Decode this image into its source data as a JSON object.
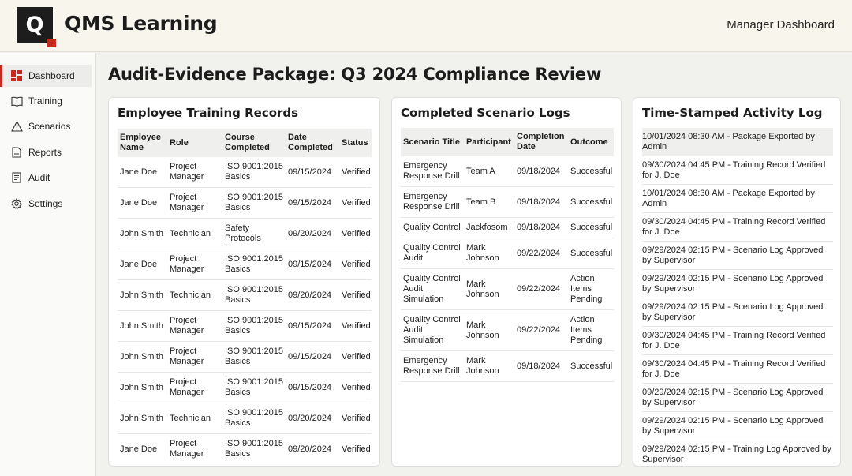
{
  "header": {
    "logo_letter": "Q",
    "app_title": "QMS Learning",
    "right_label": "Manager Dashboard"
  },
  "sidebar": {
    "items": [
      {
        "label": "Dashboard",
        "icon": "dashboard-icon",
        "active": true
      },
      {
        "label": "Training",
        "icon": "book-icon",
        "active": false
      },
      {
        "label": "Scenarios",
        "icon": "warning-icon",
        "active": false
      },
      {
        "label": "Reports",
        "icon": "document-icon",
        "active": false
      },
      {
        "label": "Audit",
        "icon": "clipboard-icon",
        "active": false
      },
      {
        "label": "Settings",
        "icon": "gear-icon",
        "active": false
      }
    ]
  },
  "page_title": "Audit-Evidence Package: Q3 2024 Compliance Review",
  "training": {
    "title": "Employee Training Records",
    "headers": [
      "Employee Name",
      "Role",
      "Course Completed",
      "Date Completed",
      "Status"
    ],
    "rows": [
      [
        "Jane Doe",
        "Project Manager",
        "ISO 9001:2015 Basics",
        "09/15/2024",
        "Verified"
      ],
      [
        "Jane Doe",
        "Project Manager",
        "ISO 9001:2015 Basics",
        "09/15/2024",
        "Verified"
      ],
      [
        "John Smith",
        "Technician",
        "Safety Protocols",
        "09/20/2024",
        "Verified"
      ],
      [
        "Jane Doe",
        "Project Manager",
        "ISO 9001:2015 Basics",
        "09/15/2024",
        "Verified"
      ],
      [
        "John Smith",
        "Technician",
        "ISO 9001:2015 Basics",
        "09/20/2024",
        "Verified"
      ],
      [
        "John Smith",
        "Project Manager",
        "ISO 9001:2015 Basics",
        "09/15/2024",
        "Verified"
      ],
      [
        "John Smith",
        "Project Manager",
        "ISO 9001:2015 Basics",
        "09/15/2024",
        "Verified"
      ],
      [
        "John Smith",
        "Project Manager",
        "ISO 9001:2015 Basics",
        "09/15/2024",
        "Verified"
      ],
      [
        "John Smith",
        "Technician",
        "ISO 9001:2015 Basics",
        "09/20/2024",
        "Verified"
      ],
      [
        "Jane Doe",
        "Project Manager",
        "ISO 9001:2015 Basics",
        "09/20/2024",
        "Verified"
      ]
    ]
  },
  "scenarios": {
    "title": "Completed Scenario Logs",
    "headers": [
      "Scenario Title",
      "Participant",
      "Completion Date",
      "Outcome"
    ],
    "rows": [
      [
        "Emergency Response Drill",
        "Team A",
        "09/18/2024",
        "Successful"
      ],
      [
        "Emergency Response Drill",
        "Team B",
        "09/18/2024",
        "Successful"
      ],
      [
        "Quality Control",
        "Jackfosom",
        "09/18/2024",
        "Successful"
      ],
      [
        "Quality Control Audit",
        "Mark Johnson",
        "09/22/2024",
        "Successful"
      ],
      [
        "Quality Control Audit Simulation",
        "Mark Johnson",
        "09/22/2024",
        "Action Items Pending"
      ],
      [
        "Quality Control Audit Simulation",
        "Mark Johnson",
        "09/22/2024",
        "Action Items Pending"
      ],
      [
        "Emergency Response Drill",
        "Mark Johnson",
        "09/18/2024",
        "Successful"
      ]
    ]
  },
  "activity": {
    "title": "Time-Stamped Activity Log",
    "items": [
      "10/01/2024 08:30 AM - Package Exported by Admin",
      "09/30/2024 04:45 PM - Training Record Verified for J. Doe",
      "10/01/2024 08:30 AM - Package Exported by Admin",
      "09/30/2024 04:45 PM - Training Record Verified for J. Doe",
      "09/29/2024 02:15 PM - Scenario Log Approved by Supervisor",
      "09/29/2024 02:15 PM - Scenario Log Approved by Supervisor",
      "09/29/2024 02:15 PM - Scenario Log Approved by Supervisor",
      "09/30/2024 04:45 PM - Training Record Verified for J. Doe",
      "09/30/2024 04:45 PM - Training Record Verified for J. Doe",
      "09/29/2024 02:15 PM - Scenario Log Approved by Supervisor",
      "09/29/2024 02:15 PM - Scenario Log Approved by Supervisor",
      "09/29/2024 02:15 PM - Training Log Approved by Supervisor"
    ]
  },
  "colors": {
    "accent": "#c8281e",
    "header_bg": "#f8f6ec",
    "logo_bg": "#1d1d1d"
  }
}
